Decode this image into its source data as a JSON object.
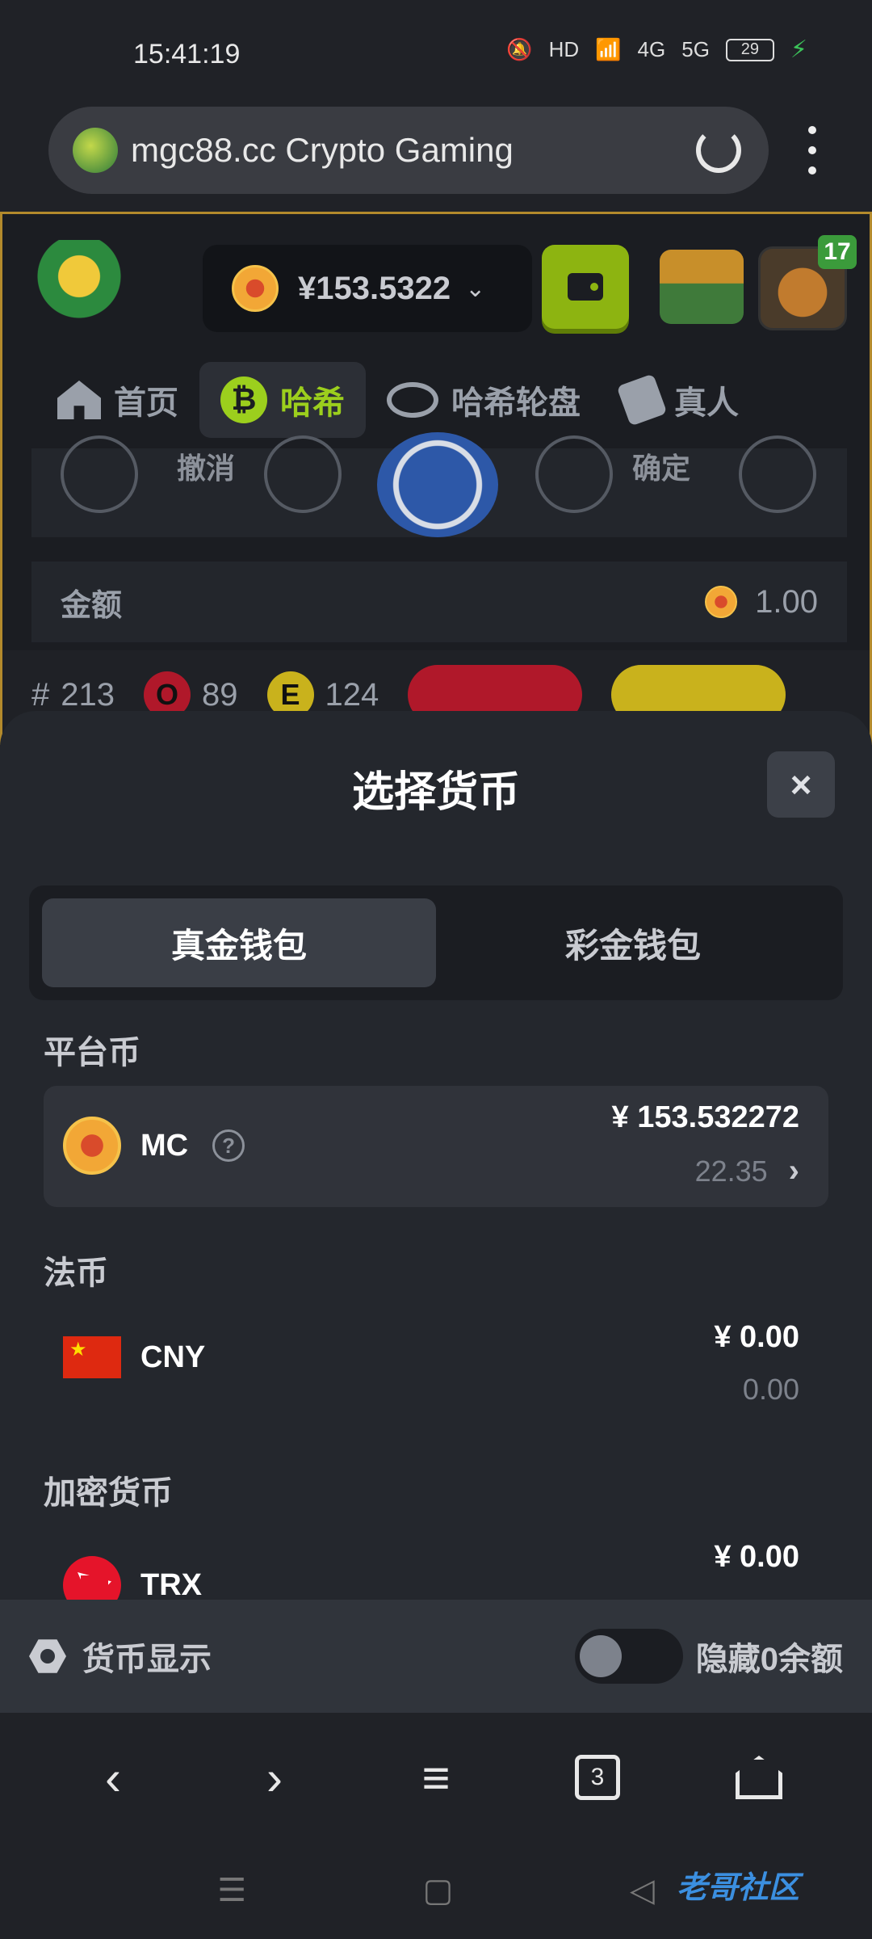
{
  "status_bar": {
    "time": "15:41:19",
    "network_1": "4G",
    "network_2": "5G",
    "battery": "29",
    "hd": "HD"
  },
  "browser": {
    "url": "mgc88.cc Crypto Gaming",
    "tab_count": "3"
  },
  "site": {
    "balance": "¥153.5322",
    "level_badge": "17",
    "nav_tabs": [
      {
        "label": "首页",
        "icon": "home-icon"
      },
      {
        "label": "哈希",
        "icon": "bitcoin-icon"
      },
      {
        "label": "哈希轮盘",
        "icon": "roulette-icon"
      },
      {
        "label": "真人",
        "icon": "cards-icon"
      }
    ],
    "controls": {
      "undo": "撤消",
      "confirm": "确定"
    },
    "amount": {
      "label": "金额",
      "value": "1.00"
    },
    "stats": {
      "hash_prefix": "#",
      "round": "213",
      "odd_label": "O",
      "odd_count": "89",
      "even_label": "E",
      "even_count": "124"
    }
  },
  "sheet": {
    "title": "选择货币",
    "close": "×",
    "tabs": [
      "真金钱包",
      "彩金钱包"
    ],
    "sections": {
      "platform": "平台币",
      "fiat": "法币",
      "crypto": "加密货币"
    },
    "currencies": {
      "mc": {
        "code": "MC",
        "help": "?",
        "amount": "¥ 153.532272",
        "sub": "22.35"
      },
      "cny": {
        "code": "CNY",
        "amount": "¥ 0.00",
        "sub": "0.00"
      },
      "trx": {
        "code": "TRX",
        "amount": "¥ 0.00"
      }
    },
    "footer": {
      "currency_display": "货币显示",
      "hide_zero": "隐藏0余额"
    }
  },
  "watermark": "老哥社区",
  "colors": {
    "accent": "#9ccf1d",
    "odd": "#b0182a",
    "even": "#c9b21c",
    "sheet_bg": "#24272d"
  }
}
